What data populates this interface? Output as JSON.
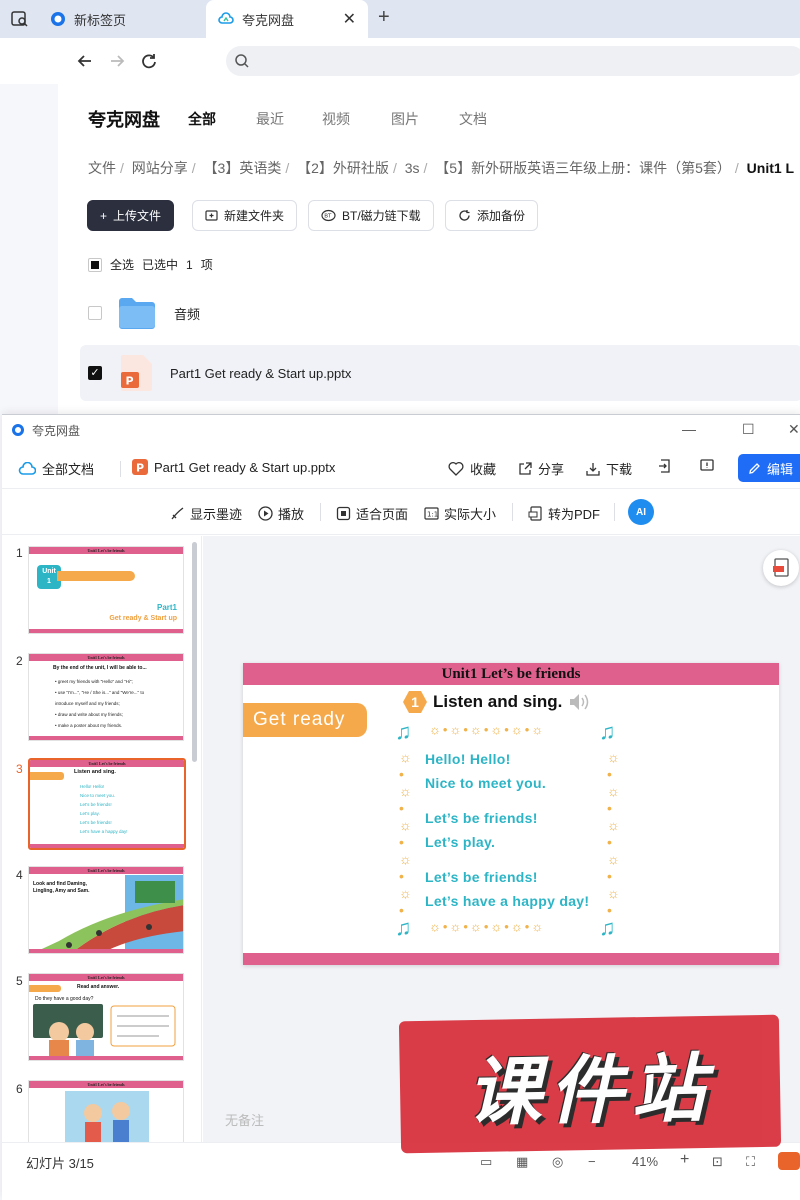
{
  "browser": {
    "tabs": [
      {
        "label": "新标签页"
      },
      {
        "label": "夸克网盘"
      }
    ],
    "close_glyph": "✕",
    "new_tab_glyph": "+"
  },
  "drive": {
    "brand": "夸克网盘",
    "nav_tabs": [
      "全部",
      "最近",
      "视频",
      "图片",
      "文档"
    ],
    "breadcrumb": [
      "文件",
      "网站分享",
      "【3】英语类",
      "【2】外研社版",
      "3s",
      "【5】新外研版英语三年级上册：课件（第5套）",
      "Unit1 L"
    ],
    "actions": {
      "upload": "上传文件",
      "new_folder": "新建文件夹",
      "bt_download": "BT/磁力链下载",
      "add_backup": "添加备份"
    },
    "select_all": "全选",
    "selected_prefix": "已选中",
    "selected_count": "1",
    "selected_unit": "项",
    "files": [
      {
        "name": "音频",
        "type": "folder"
      },
      {
        "name": "Part1 Get ready & Start up.pptx",
        "type": "pptx"
      }
    ]
  },
  "preview": {
    "window_title": "夸克网盘",
    "all_docs": "全部文档",
    "file_name": "Part1 Get ready & Start up.pptx",
    "header_actions": {
      "favorite": "收藏",
      "share": "分享",
      "download": "下载",
      "edit": "编辑"
    },
    "tools": {
      "show_ink": "显示墨迹",
      "play": "播放",
      "fit_page": "适合页面",
      "actual_size": "实际大小",
      "to_pdf": "转为PDF",
      "ai": "AI"
    },
    "thumbnails": [
      {
        "num": "1",
        "title": "Unit1 Let's be friends"
      },
      {
        "num": "2",
        "title": "Unit1 Let's be friends"
      },
      {
        "num": "3",
        "title": "Unit1 Let's be friends"
      },
      {
        "num": "4",
        "title": "Unit1 Let's be friends"
      },
      {
        "num": "5",
        "title": "Unit1 Let's be friends"
      },
      {
        "num": "6",
        "title": "Unit1 Let's be friends"
      }
    ],
    "thumb_text": {
      "t1_part": "Part1",
      "t1_sub": "Get ready & Start up",
      "t2_heading": "By the end of the unit, I will be able to...",
      "t2_items": [
        "• greet my friends with \"Hello\" and \"Hi\";",
        "• use \"I'm...\", \"He / She is...\" and \"We're...\" to",
        "  introduce myself and my friends;",
        "• draw and write about my friends;",
        "• make a poster about my friends."
      ],
      "t4_title": "Look and find Daming, Lingling, Amy and Sam.",
      "t5_title": "Read and answer.",
      "t5_q": "Do they have a good day?"
    },
    "slide": {
      "header": "Unit1 Let’s be friends",
      "badge": "Get ready",
      "activity_num": "1",
      "activity_title": "Listen and sing.",
      "lyrics": [
        "Hello! Hello!",
        "Nice to meet you.",
        "Let’s be friends!",
        "Let’s play.",
        "Let’s be friends!",
        "Let’s have a happy day!"
      ]
    },
    "notes_placeholder": "无备注",
    "slide_counter": "幻灯片 3/15",
    "zoom": "41%"
  },
  "watermark": "课件站",
  "colors": {
    "pink_bar": "#e0608d",
    "orange": "#f6a94b",
    "teal": "#2db5c6",
    "primary_btn": "#2b2f3e",
    "edit_blue": "#1f6df6",
    "active_thumb": "#e8642b",
    "stamp_red": "#d8323e"
  }
}
